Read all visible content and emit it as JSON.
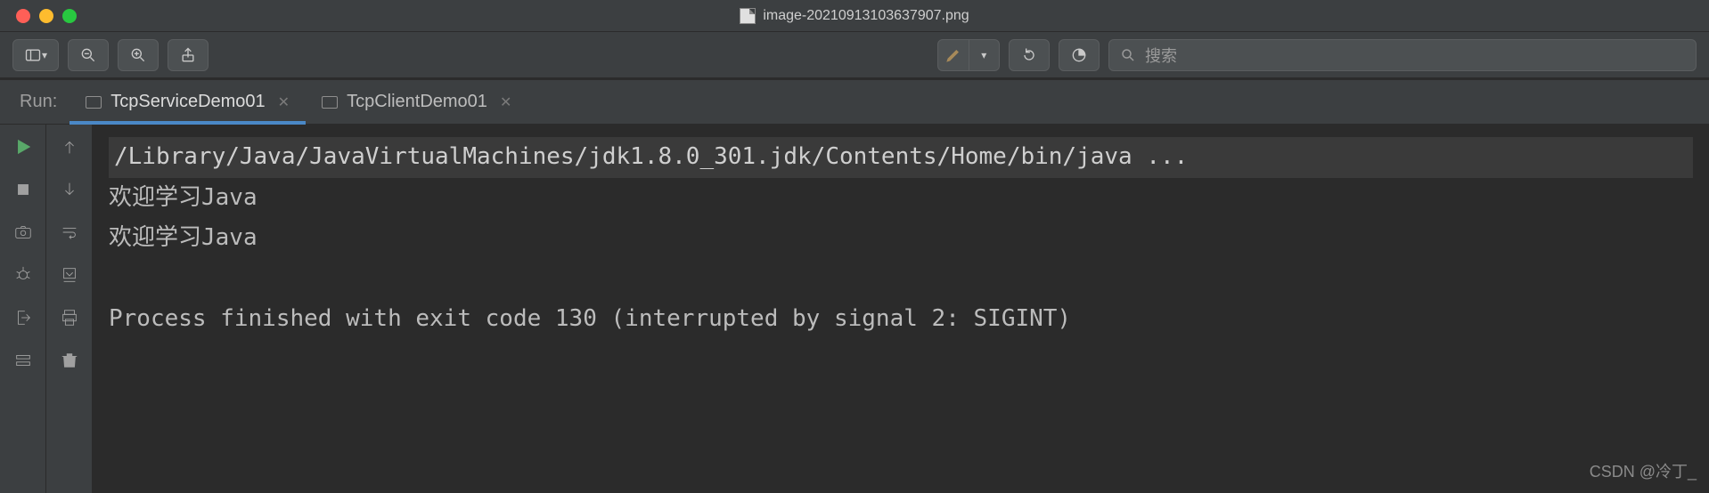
{
  "window": {
    "title": "image-20210913103637907.png"
  },
  "search": {
    "placeholder": "搜索"
  },
  "run": {
    "label": "Run:",
    "tabs": [
      {
        "label": "TcpServiceDemo01",
        "active": true
      },
      {
        "label": "TcpClientDemo01",
        "active": false
      }
    ]
  },
  "console": {
    "command": "/Library/Java/JavaVirtualMachines/jdk1.8.0_301.jdk/Contents/Home/bin/java ...",
    "lines": [
      "欢迎学习Java",
      "欢迎学习Java",
      "",
      "Process finished with exit code 130 (interrupted by signal 2: SIGINT)"
    ]
  },
  "watermark": "CSDN @冷丁_"
}
